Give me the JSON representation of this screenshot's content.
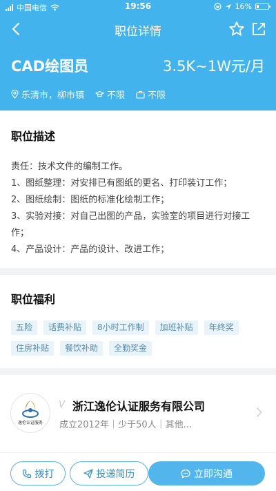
{
  "status_bar": {
    "carrier": "中国电信",
    "time": "19:56",
    "battery": "16%"
  },
  "nav": {
    "title": "职位详情"
  },
  "job": {
    "title": "CAD绘图员",
    "salary": "3.5K~1W元/月",
    "location": "乐清市，柳市镇",
    "education": "不限",
    "experience": "不限"
  },
  "description": {
    "title": "职位描述",
    "lines": [
      "责任：技术文件的编制工作。",
      "1、图纸整理：对安排已有图纸的更名、打印装订工作；",
      "2、图纸绘制：图纸的标准化绘制工作；",
      "3、实验对接：对自己出图的产品，实验室的项目进行对接工作；",
      "4、产品设计：产品的设计、改进工作；"
    ]
  },
  "welfare": {
    "title": "职位福利",
    "tags": [
      "五险",
      "话费补贴",
      "8小时工作制",
      "加班补贴",
      "年终奖",
      "住房补贴",
      "餐饮补助",
      "全勤奖金"
    ]
  },
  "company": {
    "name": "浙江逸伦认证服务有限公司",
    "info": "成立2012年｜少于50人｜其他...",
    "logo_text": "逸伦认证服务"
  },
  "actions": {
    "call": "拨打",
    "resume": "投递简历",
    "chat": "立即沟通"
  },
  "colors": {
    "accent": "#42b3ec",
    "tag_bg": "#e8f4fa",
    "tag_text": "#5a8aa8"
  }
}
